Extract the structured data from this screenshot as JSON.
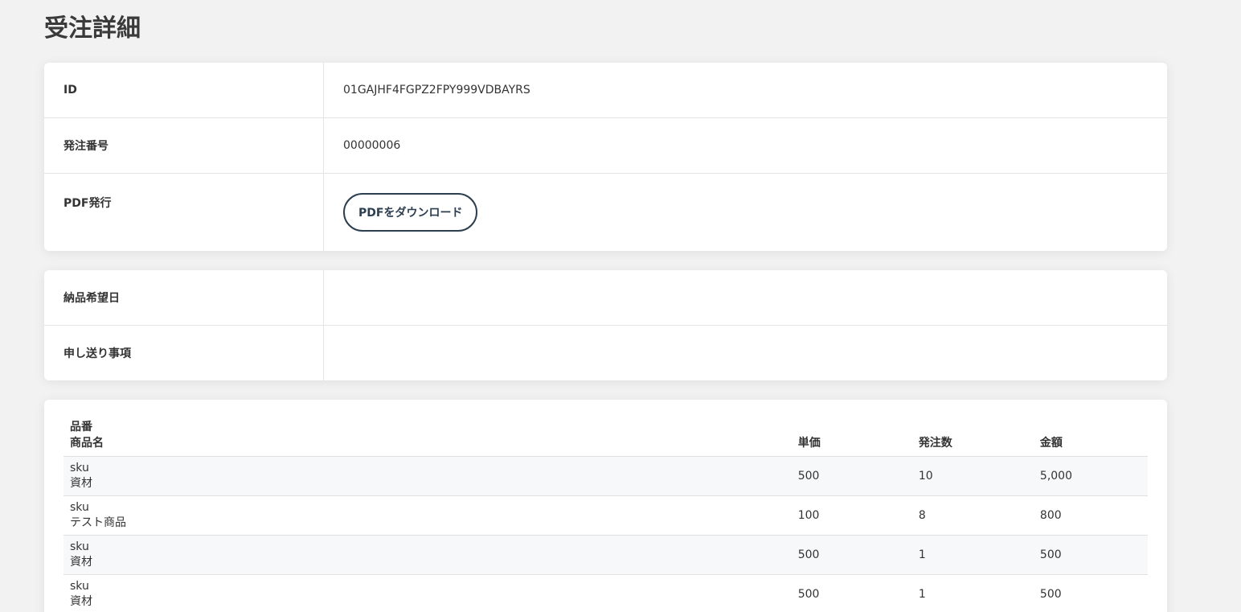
{
  "page": {
    "title": "受注詳細"
  },
  "summary": {
    "id_label": "ID",
    "id_value": "01GAJHF4FGPZ2FPY999VDBAYRS",
    "order_number_label": "発注番号",
    "order_number_value": "00000006",
    "pdf_label": "PDF発行",
    "pdf_button_label": "PDFをダウンロード"
  },
  "delivery": {
    "desired_date_label": "納品希望日",
    "desired_date_value": "",
    "notes_label": "申し送り事項",
    "notes_value": ""
  },
  "items_table": {
    "headers": {
      "product_code": "品番",
      "product_name": "商品名",
      "unit_price": "単価",
      "quantity": "発注数",
      "amount": "金額"
    },
    "rows": [
      {
        "code": "sku",
        "name": "資材",
        "unit_price": "500",
        "quantity": "10",
        "amount": "5,000"
      },
      {
        "code": "sku",
        "name": "テスト商品",
        "unit_price": "100",
        "quantity": "8",
        "amount": "800"
      },
      {
        "code": "sku",
        "name": "資材",
        "unit_price": "500",
        "quantity": "1",
        "amount": "500"
      },
      {
        "code": "sku",
        "name": "資材",
        "unit_price": "500",
        "quantity": "1",
        "amount": "500"
      }
    ]
  }
}
